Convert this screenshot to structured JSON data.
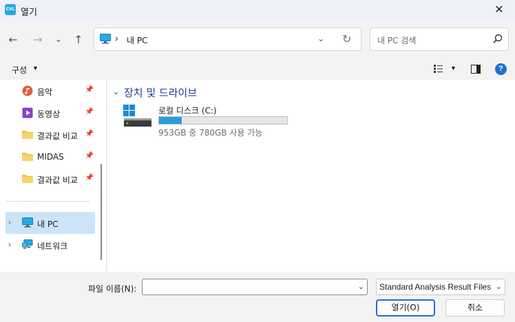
{
  "window": {
    "title": "열기",
    "app_icon_text": "CVL"
  },
  "nav": {
    "back": "←",
    "forward": "→",
    "recent": "⌄",
    "up": "↑",
    "address_sep": "›",
    "address_text": "내 PC",
    "refresh": "↻",
    "search_placeholder": "내 PC 검색"
  },
  "toolbar": {
    "organize_label": "구성"
  },
  "sidebar": {
    "items": [
      {
        "label": "음악",
        "icon": "music-icon",
        "pinned": true
      },
      {
        "label": "동영상",
        "icon": "video-icon",
        "pinned": true
      },
      {
        "label": "결과값 비교",
        "icon": "folder-icon",
        "pinned": true
      },
      {
        "label": "MIDAS",
        "icon": "folder-icon",
        "pinned": true
      },
      {
        "label": "결과값 비교",
        "icon": "folder-icon",
        "pinned": true
      },
      {
        "label": "내 PC",
        "icon": "pc-icon",
        "selected": true
      },
      {
        "label": "네트워크",
        "icon": "network-icon"
      }
    ]
  },
  "content": {
    "group_title": "장치 및 드라이브",
    "drives": [
      {
        "name": "로컬 디스크 (C:)",
        "free_text": "953GB 중 780GB 사용 가능",
        "used_fraction": 0.18
      }
    ]
  },
  "footer": {
    "filename_label": "파일 이름(N):",
    "filename_value": "",
    "filetype_value": "Standard Analysis Result Files(*",
    "open_label": "열기(O)",
    "cancel_label": "취소"
  },
  "colors": {
    "accent": "#1e6fd1",
    "drive_fill": "#26a0da",
    "group_title": "#1f3b8c",
    "selected": "#cce4f7"
  }
}
